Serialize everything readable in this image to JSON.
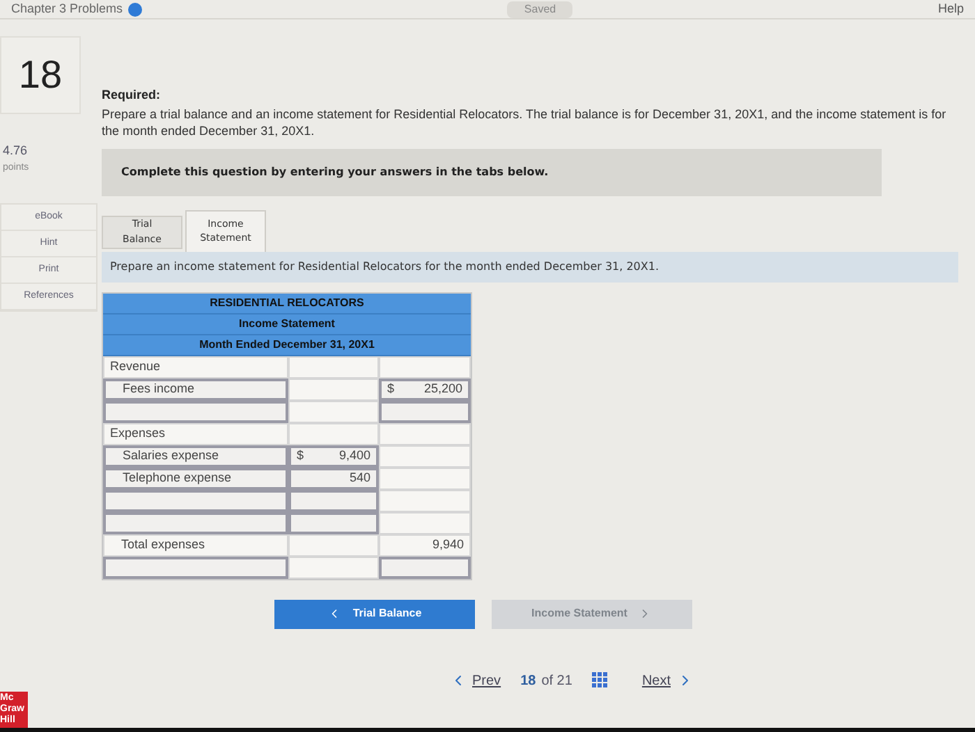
{
  "top_bar": {
    "chapter": "Chapter 3 Problems",
    "status": "Saved",
    "help": "Help"
  },
  "question": {
    "number": "18",
    "points": "4.76",
    "points_label": "points"
  },
  "side_buttons": [
    "eBook",
    "Hint",
    "Print",
    "References"
  ],
  "required_label": "Required:",
  "required_text": "Prepare a trial balance and an income statement for Residential Relocators. The trial balance is for December 31, 20X1, and the income statement is for the month ended December 31, 20X1.",
  "instruction": "Complete this question by entering your answers in the tabs below.",
  "tabs": [
    {
      "label": "Trial Balance",
      "selected": false
    },
    {
      "label": "Income Statement",
      "selected": true
    }
  ],
  "tab_prompt": "Prepare an income statement for Residential Relocators for the month ended December 31, 20X1.",
  "statement": {
    "header": [
      "RESIDENTIAL RELOCATORS",
      "Income Statement",
      "Month Ended December 31, 20X1"
    ],
    "rows": [
      {
        "kind": "section",
        "label": "Revenue"
      },
      {
        "kind": "entry",
        "label": "Fees income",
        "right": {
          "kind": "field",
          "dollar": "$",
          "amount": "25,200"
        }
      },
      {
        "kind": "entry",
        "right": {
          "kind": "field"
        }
      },
      {
        "kind": "section",
        "label": "Expenses"
      },
      {
        "kind": "entry",
        "label": "Salaries expense",
        "middle": {
          "kind": "field",
          "dollar": "$",
          "amount": "9,400"
        }
      },
      {
        "kind": "entry",
        "label": "Telephone expense",
        "middle": {
          "kind": "field",
          "amount": "540"
        }
      },
      {
        "kind": "entry",
        "middle": {
          "kind": "field"
        }
      },
      {
        "kind": "entry",
        "middle": {
          "kind": "field"
        }
      },
      {
        "kind": "total",
        "label": "Total expenses",
        "right": {
          "kind": "plain",
          "amount": "9,940"
        }
      },
      {
        "kind": "entry",
        "right": {
          "kind": "field"
        }
      }
    ]
  },
  "nav_buttons": [
    {
      "label": "Trial Balance",
      "kind": "back",
      "disabled": false
    },
    {
      "label": "Income Statement",
      "kind": "forward",
      "disabled": true
    }
  ],
  "logo": [
    "Mc",
    "Graw",
    "Hill"
  ],
  "pager": {
    "prev": "Prev",
    "current": "18",
    "total": "of 21",
    "next": "Next"
  }
}
